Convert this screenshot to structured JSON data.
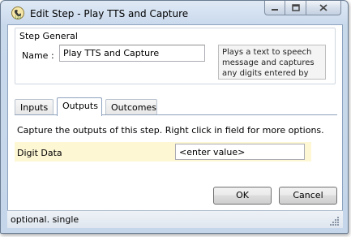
{
  "window": {
    "title": "Edit Step - Play TTS and Capture",
    "icon": "phone-step-icon"
  },
  "caption_buttons": {
    "minimize_icon": "minimize-icon",
    "maximize_icon": "maximize-icon",
    "close_icon": "close-icon"
  },
  "step_general": {
    "legend": "Step General",
    "name_label": "Name :",
    "name_value": "Play TTS and Capture",
    "description": "Plays a text to speech message and captures any digits entered by the"
  },
  "tabs": [
    {
      "label": "Inputs",
      "active": false
    },
    {
      "label": "Outputs",
      "active": true
    },
    {
      "label": "Outcomes",
      "active": false
    }
  ],
  "outputs": {
    "description": "Capture the outputs of this step.  Right click in field for more options.",
    "rows": [
      {
        "label": "Digit Data",
        "value": "<enter value>"
      }
    ]
  },
  "buttons": {
    "ok": "OK",
    "cancel": "Cancel"
  },
  "status": {
    "text": "optional. single"
  },
  "colors": {
    "title_bar": "#c9d9ec",
    "row_highlight": "#fdf7d4"
  }
}
